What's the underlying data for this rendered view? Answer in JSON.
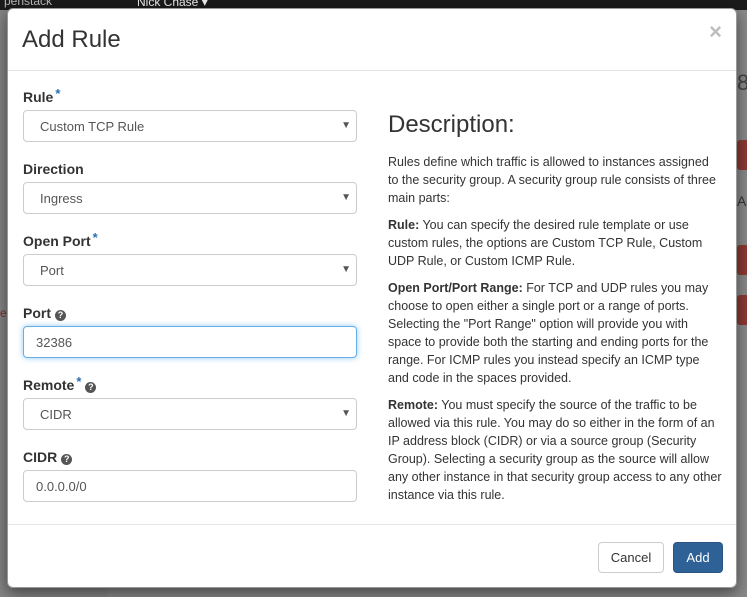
{
  "background": {
    "brand_fragment": "penstack",
    "user_name": "Nick Chase ▾",
    "right_fragment_1": "8",
    "right_fragment_2": "AC",
    "left_fragment": "e"
  },
  "modal": {
    "title": "Add Rule",
    "close_label": "×",
    "fields": {
      "rule": {
        "label": "Rule",
        "required": "*",
        "value": "Custom TCP Rule"
      },
      "direction": {
        "label": "Direction",
        "value": "Ingress"
      },
      "open_port": {
        "label": "Open Port",
        "required": "*",
        "value": "Port"
      },
      "port": {
        "label": "Port",
        "value": "32386"
      },
      "remote": {
        "label": "Remote",
        "required": "*",
        "value": "CIDR"
      },
      "cidr": {
        "label": "CIDR",
        "value": "0.0.0.0/0"
      }
    },
    "description": {
      "title": "Description:",
      "intro": "Rules define which traffic is allowed to instances assigned to the security group. A security group rule consists of three main parts:",
      "rule_term": "Rule:",
      "rule_text": " You can specify the desired rule template or use custom rules, the options are Custom TCP Rule, Custom UDP Rule, or Custom ICMP Rule.",
      "port_term": "Open Port/Port Range:",
      "port_text": " For TCP and UDP rules you may choose to open either a single port or a range of ports. Selecting the \"Port Range\" option will provide you with space to provide both the starting and ending ports for the range. For ICMP rules you instead specify an ICMP type and code in the spaces provided.",
      "remote_term": "Remote:",
      "remote_text": " You must specify the source of the traffic to be allowed via this rule. You may do so either in the form of an IP address block (CIDR) or via a source group (Security Group). Selecting a security group as the source will allow any other instance in that security group access to any other instance via this rule."
    },
    "buttons": {
      "cancel": "Cancel",
      "add": "Add"
    }
  },
  "icons": {
    "caret": "caret-down-icon",
    "help": "question-circle-icon",
    "close": "close-icon"
  }
}
